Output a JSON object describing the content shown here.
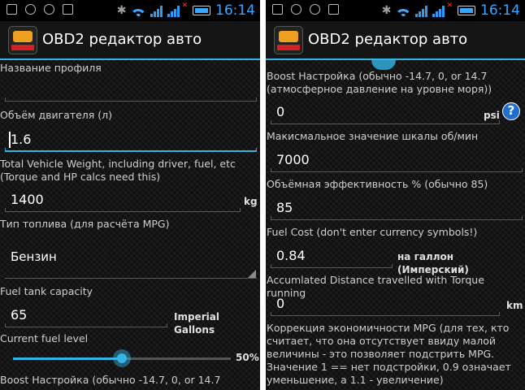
{
  "status_bar": {
    "time": "16:14"
  },
  "app": {
    "title": "OBD2 редактор авто"
  },
  "left": {
    "profile_name_label": "Название профиля",
    "engine_label": "Объём двигателя (л)",
    "engine_value": "1.6",
    "weight_label_1": "Total Vehicle Weight, including driver, fuel, etc",
    "weight_label_2": "(Torque and HP calcs need this)",
    "weight_value": "1400",
    "weight_unit": "kg",
    "fuel_type_label": "Тип топлива (для расчёта MPG)",
    "fuel_type_value": "Бензин",
    "tank_label": "Fuel tank capacity",
    "tank_value": "65",
    "tank_unit": "Imperial Gallons",
    "fuel_level_label": "Current fuel level",
    "fuel_level_value": "50%",
    "fuel_level_fraction": 0.5,
    "boost_label_partial": "Boost Настройка (обычно -14.7, 0, or 14.7"
  },
  "right": {
    "boost_label_1": "Boost Настройка (обычно -14.7, 0, or 14.7",
    "boost_label_2": "(атмосферное давление на уровне моря))",
    "boost_value": "0",
    "boost_unit": "psi",
    "help_glyph": "?",
    "rpm_label": "Макисмальное значение шкалы об/мин",
    "rpm_value": "7000",
    "ve_label": "Объёмная эффективность % (обычно 85)",
    "ve_value": "85",
    "cost_label": "Fuel Cost (don't enter currency symbols!)",
    "cost_value": "0.84",
    "cost_unit": "на галлон (Имперский)",
    "distance_label": "Accumlated Distance travelled with Torque running",
    "distance_value": "0",
    "distance_unit": "km",
    "mpg_label_1": "Коррекция экономичности MPG (для тех, кто",
    "mpg_label_2": "считает, что она отсутствует ввиду малой",
    "mpg_label_3": "величины - это позволяет подстрить MPG.",
    "mpg_label_4": "Значение 1 == нет подстройки, 0.9 означает",
    "mpg_label_5": "уменьшение, а 1.1 - увеличение)"
  },
  "colors": {
    "accent": "#33b5e5",
    "background": "#151515",
    "text": "#ffffff"
  }
}
